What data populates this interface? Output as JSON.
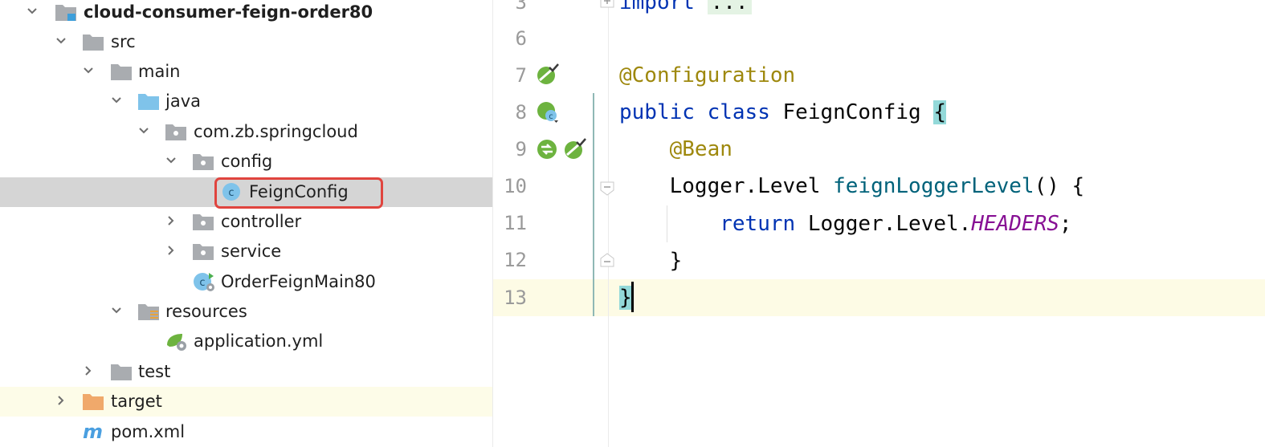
{
  "tree": {
    "items": [
      {
        "label": "cloud-consumer-feign-order80",
        "icon": "module-folder-icon",
        "expanded": true
      },
      {
        "label": "src",
        "icon": "folder-icon",
        "expanded": true
      },
      {
        "label": "main",
        "icon": "folder-icon",
        "expanded": true
      },
      {
        "label": "java",
        "icon": "source-root-folder-icon",
        "expanded": true
      },
      {
        "label": "com.zb.springcloud",
        "icon": "package-icon",
        "expanded": true
      },
      {
        "label": "config",
        "icon": "package-icon",
        "expanded": true
      },
      {
        "label": "FeignConfig",
        "icon": "class-icon",
        "selected": true
      },
      {
        "label": "controller",
        "icon": "package-icon",
        "expanded": false
      },
      {
        "label": "service",
        "icon": "package-icon",
        "expanded": false
      },
      {
        "label": "OrderFeignMain80",
        "icon": "spring-boot-class-icon"
      },
      {
        "label": "resources",
        "icon": "resources-folder-icon",
        "expanded": true
      },
      {
        "label": "application.yml",
        "icon": "spring-yaml-icon"
      },
      {
        "label": "test",
        "icon": "folder-icon",
        "expanded": false
      },
      {
        "label": "target",
        "icon": "excluded-folder-icon",
        "expanded": false
      },
      {
        "label": "pom.xml",
        "icon": "maven-icon"
      }
    ]
  },
  "editor": {
    "line_numbers": [
      "3",
      "6",
      "7",
      "8",
      "9",
      "10",
      "11",
      "12",
      "13"
    ],
    "code": {
      "import_kw": "import",
      "import_folded": "...",
      "annotation_configuration": "@Configuration",
      "kw_public": "public",
      "kw_class": "class",
      "class_name": "FeignConfig",
      "open_brace": "{",
      "annotation_bean": "@Bean",
      "type_logger_level": "Logger.Level",
      "method_name": "feignLoggerLevel",
      "method_sig_tail": "() {",
      "kw_return": "return",
      "return_expr": "Logger.Level.",
      "const_headers": "HEADERS",
      "semicolon": ";",
      "inner_close": "}",
      "close_brace": "}"
    }
  },
  "colors": {
    "keyword": "#0033b3",
    "annotation": "#9e880d",
    "method": "#00627a",
    "constant": "#871094",
    "selection": "#d5d5d5",
    "highlight_border": "#e0443e",
    "brace_match": "#93d9d9",
    "caret_line": "#fdfbe5"
  }
}
